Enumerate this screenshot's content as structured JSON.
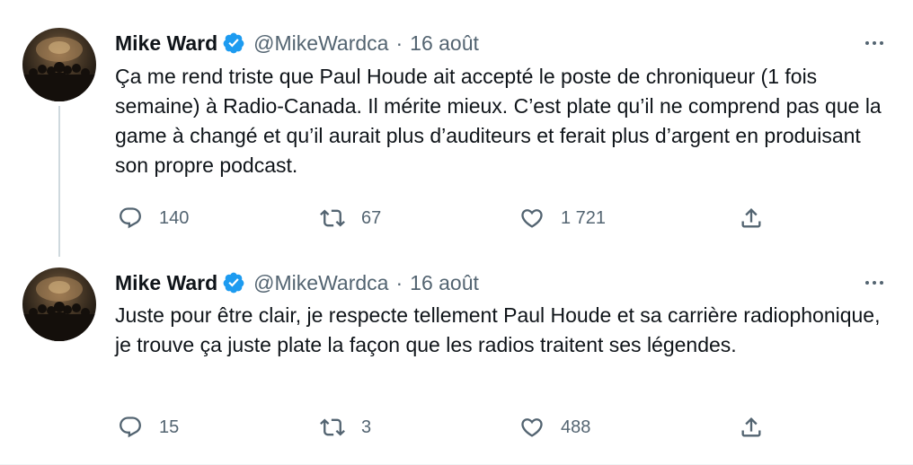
{
  "colors": {
    "text": "#0f1419",
    "secondary": "#536471",
    "verified": "#1d9bf0",
    "thread_line": "#cfd9de"
  },
  "tweets": [
    {
      "author_name": "Mike Ward",
      "handle": "@MikeWardca",
      "separator": "·",
      "date": "16 août",
      "verified_icon": "verified-badge-icon",
      "text": "Ça me rend triste que Paul Houde ait accepté le poste de chroniqueur (1 fois semaine) à Radio-Canada. Il mérite mieux. C’est plate qu’il ne comprend pas que la game à changé et qu’il aurait plus d’auditeurs et ferait plus d’argent en produisant son propre podcast.",
      "replies": "140",
      "retweets": "67",
      "likes": "1 721"
    },
    {
      "author_name": "Mike Ward",
      "handle": "@MikeWardca",
      "separator": "·",
      "date": "16 août",
      "verified_icon": "verified-badge-icon",
      "text": "Juste pour être clair, je respecte tellement Paul Houde et sa carrière radiophonique, je trouve ça juste plate la façon que les radios traitent ses légendes.",
      "replies": "15",
      "retweets": "3",
      "likes": "488"
    }
  ]
}
